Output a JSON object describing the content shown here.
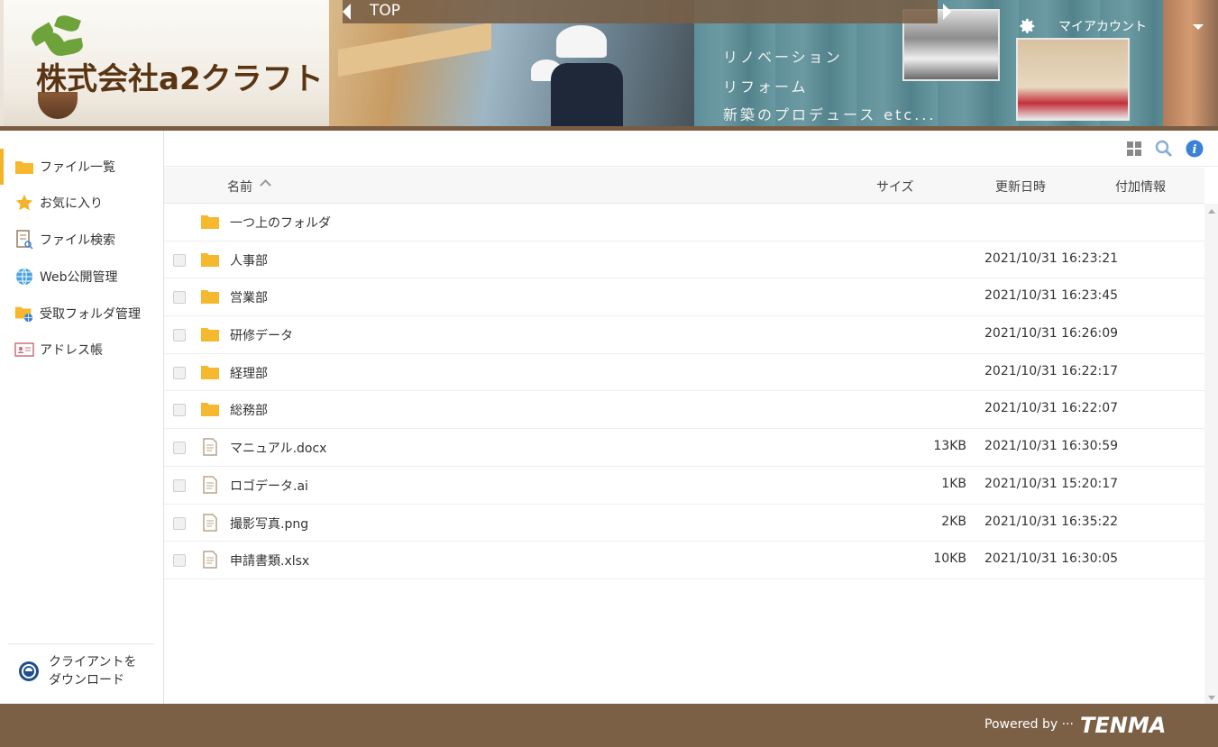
{
  "header": {
    "company_name": "株式会社a2クラフト",
    "breadcrumb": "TOP",
    "taglines": [
      "リノベーション",
      "リフォーム",
      "新築のプロデュース etc..."
    ],
    "account_label": "マイアカウント"
  },
  "sidebar": {
    "items": [
      {
        "label": "ファイル一覧",
        "icon": "folder-icon"
      },
      {
        "label": "お気に入り",
        "icon": "star-icon"
      },
      {
        "label": "ファイル検索",
        "icon": "file-search-icon"
      },
      {
        "label": "Web公開管理",
        "icon": "globe-icon"
      },
      {
        "label": "受取フォルダ管理",
        "icon": "shared-folder-icon"
      },
      {
        "label": "アドレス帳",
        "icon": "address-card-icon"
      }
    ],
    "download_line1": "クライアントを",
    "download_line2": "ダウンロード"
  },
  "table": {
    "columns": {
      "name": "名前",
      "size": "サイズ",
      "updated": "更新日時",
      "extra": "付加情報"
    },
    "parent_folder": "一つ上のフォルダ",
    "rows": [
      {
        "name": "人事部",
        "type": "folder",
        "size": "",
        "updated": "2021/10/31 16:23:21"
      },
      {
        "name": "営業部",
        "type": "folder",
        "size": "",
        "updated": "2021/10/31 16:23:45"
      },
      {
        "name": "研修データ",
        "type": "folder",
        "size": "",
        "updated": "2021/10/31 16:26:09"
      },
      {
        "name": "経理部",
        "type": "folder",
        "size": "",
        "updated": "2021/10/31 16:22:17"
      },
      {
        "name": "総務部",
        "type": "folder",
        "size": "",
        "updated": "2021/10/31 16:22:07"
      },
      {
        "name": "マニュアル.docx",
        "type": "file",
        "size": "13KB",
        "updated": "2021/10/31 16:30:59"
      },
      {
        "name": "ロゴデータ.ai",
        "type": "file",
        "size": "1KB",
        "updated": "2021/10/31 15:20:17"
      },
      {
        "name": "撮影写真.png",
        "type": "file",
        "size": "2KB",
        "updated": "2021/10/31 16:35:22"
      },
      {
        "name": "申請書類.xlsx",
        "type": "file",
        "size": "10KB",
        "updated": "2021/10/31 16:30:05"
      }
    ]
  },
  "footer": {
    "powered_by": "Powered by ···",
    "brand": "TENMA"
  },
  "colors": {
    "accent": "#f3b42a",
    "footer": "#7c6046",
    "folder": "#f5b82e",
    "info": "#3b82d6"
  }
}
